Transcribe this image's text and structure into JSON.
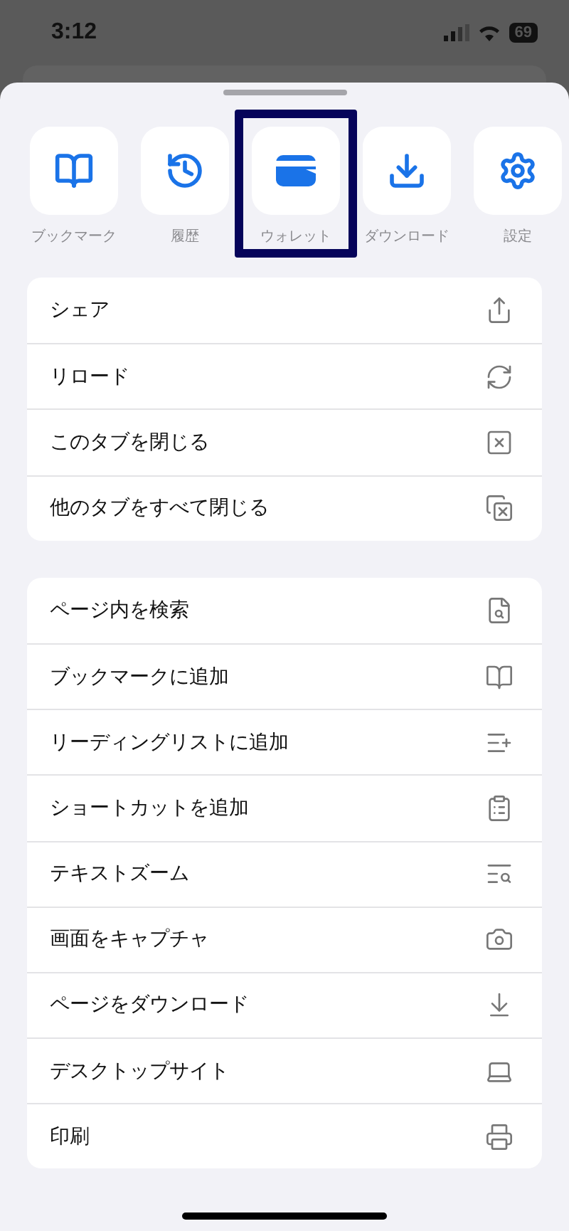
{
  "status_bar": {
    "time": "3:12",
    "battery": "69"
  },
  "quick_actions": [
    {
      "label": "ブックマーク",
      "highlighted": false
    },
    {
      "label": "履歴",
      "highlighted": false
    },
    {
      "label": "ウォレット",
      "highlighted": true
    },
    {
      "label": "ダウンロード",
      "highlighted": false
    },
    {
      "label": "設定",
      "highlighted": false
    }
  ],
  "menu_groups": [
    {
      "items": [
        "シェア",
        "リロード",
        "このタブを閉じる",
        "他のタブをすべて閉じる"
      ]
    },
    {
      "items": [
        "ページ内を検索",
        "ブックマークに追加",
        "リーディングリストに追加",
        "ショートカットを追加",
        "テキストズーム",
        "画面をキャプチャ",
        "ページをダウンロード",
        "デスクトップサイト",
        "印刷"
      ]
    }
  ]
}
